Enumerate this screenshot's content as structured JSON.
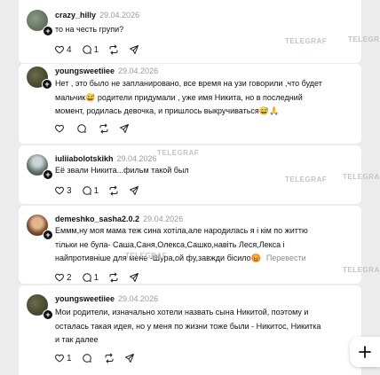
{
  "watermark": "TELEGRAF",
  "comments": [
    {
      "username": "crazy_hilly",
      "date": "29.04.2026",
      "lines": [
        "то на честь групи?"
      ],
      "translate": "",
      "likes": "4",
      "replies": "1"
    },
    {
      "username": "youngsweetiiee",
      "date": "29.04.2026",
      "lines": [
        "Нет , это было не запланировано, все время на узи говорили ,что будет",
        "мальчик😅 родители придумали , уже имя Никита, но в последний",
        "момент, родилась девочка, и пришлось выкручиваться😅🙏"
      ],
      "translate": "",
      "likes": "",
      "replies": ""
    },
    {
      "username": "iuliiabolotskikh",
      "date": "29.04.2026",
      "lines": [
        "Её звали Никита...фильм такой был"
      ],
      "translate": "",
      "likes": "3",
      "replies": "1"
    },
    {
      "username": "demeshko_sasha2.0.2",
      "date": "29.04.2026",
      "lines": [
        "Еммм,ну моя мама теж сина хотіла,але народилась я і кім по життю",
        "тільки не була- Саша,Саня,Олекса,Сашко,навіть Леся,Лекса і",
        "найпротивніше для мене -Шура,ой фу,завжди бісило😡"
      ],
      "translate": "Перевести",
      "likes": "2",
      "replies": "1"
    },
    {
      "username": "youngsweetiiee",
      "date": "29.04.2026",
      "lines": [
        "Мои родители, изначально хотели назвать сына Никитой, поэтому и",
        "осталась такая идея, но у меня по жизни тоже были - Никитос, Никитка",
        "и так далее"
      ],
      "translate": "",
      "likes": "1",
      "replies": ""
    }
  ],
  "icons": {
    "like": "heart-icon",
    "reply": "comment-icon",
    "repost": "repost-icon",
    "share": "send-icon",
    "badge": "plus-icon",
    "fab": "plus-icon"
  },
  "colors": {
    "background": "#ececec",
    "card": "#ffffff",
    "muted": "#9a9a9a",
    "watermark": "#bfc4ca"
  }
}
